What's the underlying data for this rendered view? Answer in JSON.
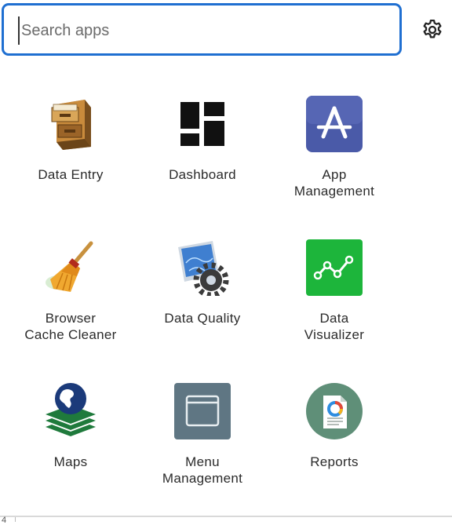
{
  "search": {
    "placeholder": "Search apps",
    "value": "",
    "border_color": "#1f6fd1"
  },
  "settings": {
    "icon": "gear-icon"
  },
  "apps": [
    {
      "label": "Data Entry",
      "icon": "file-cabinet-icon"
    },
    {
      "label": "Dashboard",
      "icon": "dashboard-icon"
    },
    {
      "label": "App\nManagement",
      "icon": "app-store-icon"
    },
    {
      "label": "Browser\nCache Cleaner",
      "icon": "broom-icon"
    },
    {
      "label": "Data Quality",
      "icon": "blueprint-gear-icon"
    },
    {
      "label": "Data\nVisualizer",
      "icon": "line-chart-icon"
    },
    {
      "label": "Maps",
      "icon": "globe-layers-icon"
    },
    {
      "label": "Menu\nManagement",
      "icon": "window-icon"
    },
    {
      "label": "Reports",
      "icon": "report-document-icon"
    }
  ],
  "footer": {
    "corner_text": "4"
  },
  "colors": {
    "app_management_bg": "#4a5aa8",
    "data_visualizer_bg": "#1db53b",
    "menu_management_bg": "#5f7683",
    "reports_bg": "#5f8f78",
    "maps_green": "#1f7a3c",
    "maps_blue": "#1b3a7a"
  }
}
